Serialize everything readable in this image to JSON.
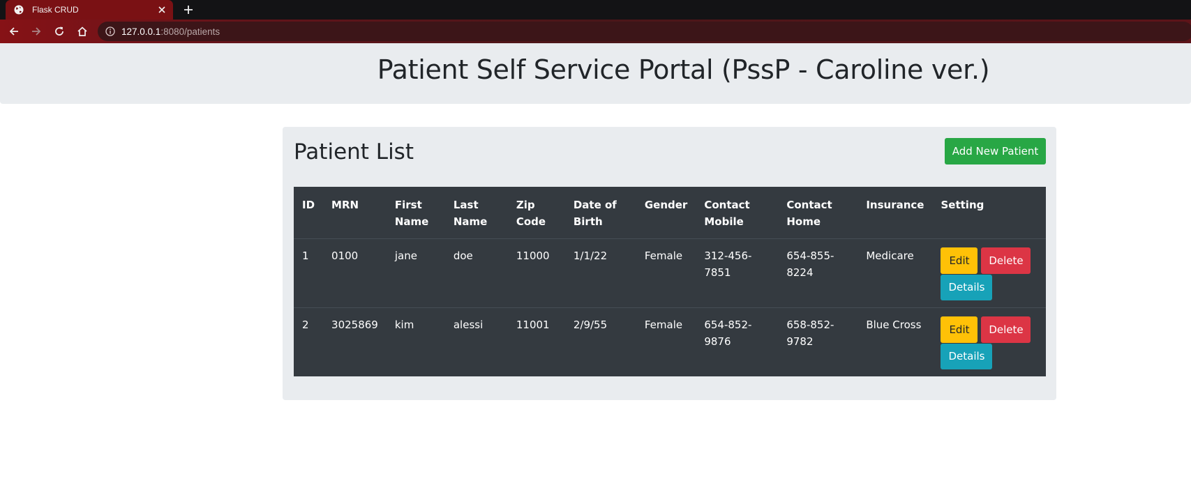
{
  "browser": {
    "tab_title": "Flask CRUD",
    "url_host": "127.0.0.1",
    "url_rest": ":8080/patients"
  },
  "header": {
    "title": "Patient Self Service Portal (PssP - Caroline ver.)"
  },
  "card": {
    "title": "Patient List",
    "add_button": "Add New Patient"
  },
  "table": {
    "columns": [
      "ID",
      "MRN",
      "First Name",
      "Last Name",
      "Zip Code",
      "Date of Birth",
      "Gender",
      "Contact Mobile",
      "Contact Home",
      "Insurance",
      "Setting"
    ],
    "rows": [
      {
        "id": "1",
        "mrn": "0100",
        "first_name": "jane",
        "last_name": "doe",
        "zip": "11000",
        "dob": "1/1/22",
        "gender": "Female",
        "mobile": "312-456-7851",
        "home": "654-855-8224",
        "insurance": "Medicare"
      },
      {
        "id": "2",
        "mrn": "3025869",
        "first_name": "kim",
        "last_name": "alessi",
        "zip": "11001",
        "dob": "2/9/55",
        "gender": "Female",
        "mobile": "654-852-9876",
        "home": "658-852-9782",
        "insurance": "Blue Cross"
      }
    ],
    "actions": {
      "edit": "Edit",
      "delete": "Delete",
      "details": "Details"
    }
  },
  "colors": {
    "tab_active": "#7a1114",
    "add_button": "#28a745",
    "edit_button": "#ffc107",
    "delete_button": "#dc3545",
    "details_button": "#17a2b8",
    "table_bg": "#343a40"
  }
}
